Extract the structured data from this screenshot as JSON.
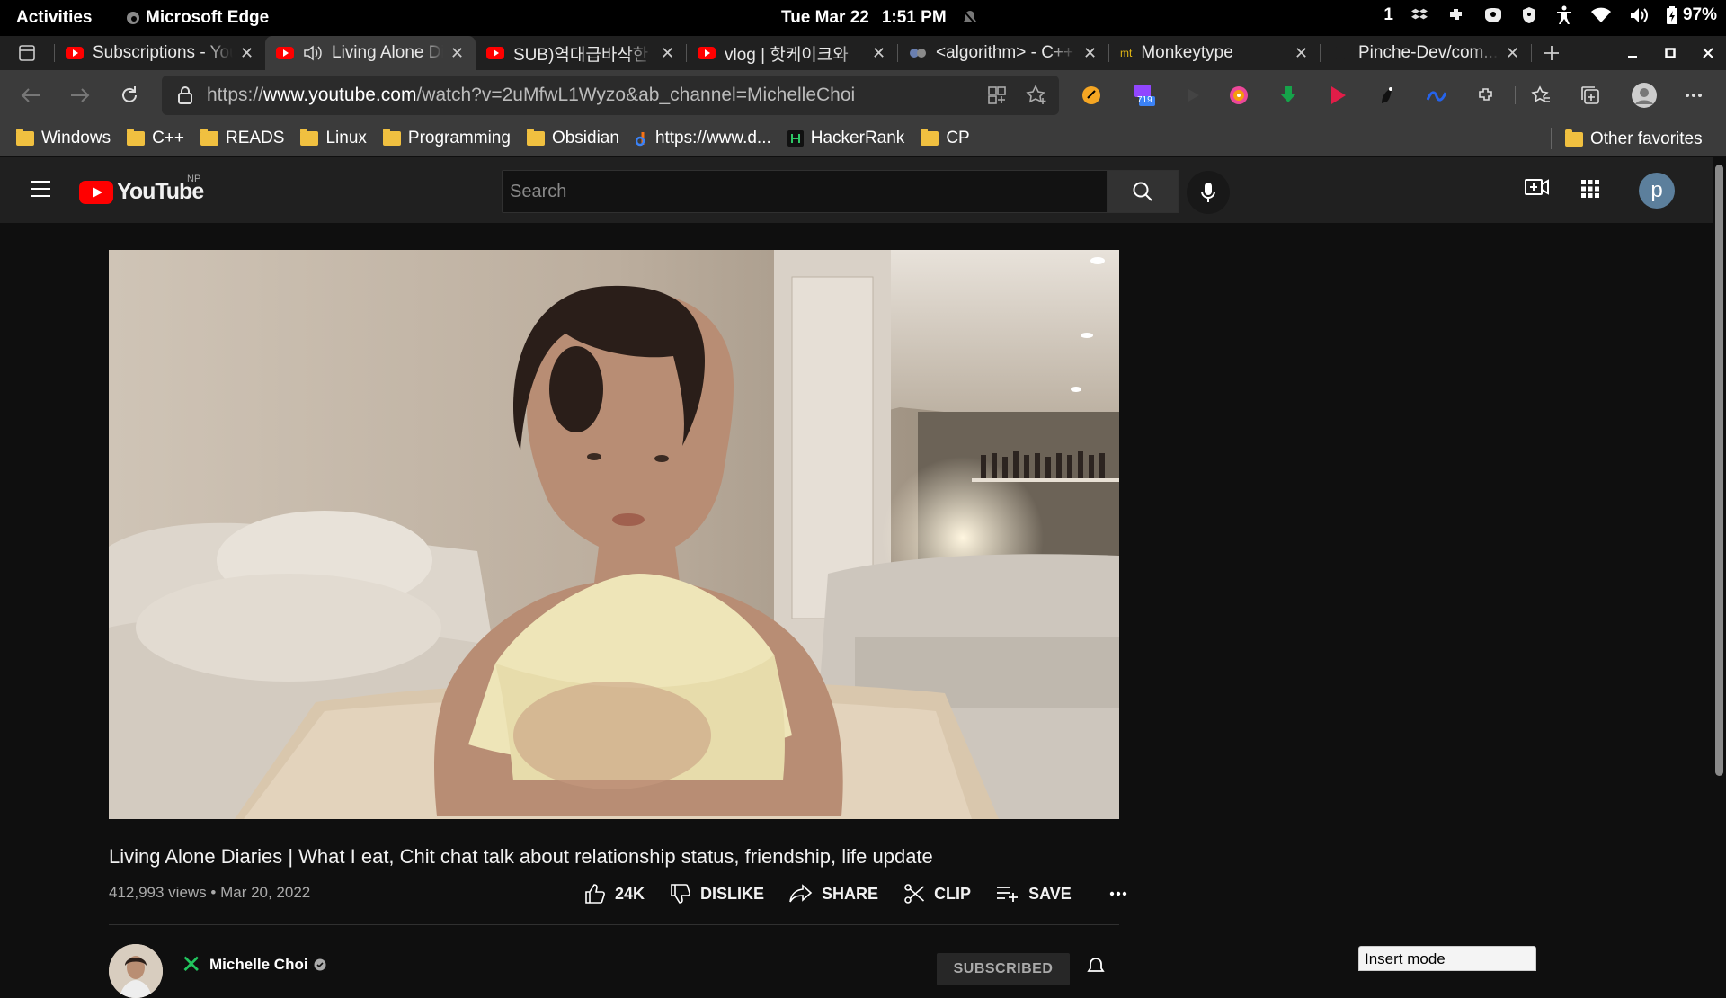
{
  "system_bar": {
    "activities": "Activities",
    "app_name": "Microsoft Edge",
    "date": "Tue Mar 22",
    "time": "1:51 PM",
    "workspace": "1",
    "battery": "97%"
  },
  "tabs": [
    {
      "title": "Subscriptions - YouTube",
      "favicon": "youtube-icon",
      "active": false
    },
    {
      "title": "Living Alone Diaries",
      "favicon": "youtube-icon",
      "audio": true,
      "active": true
    },
    {
      "title": "SUB)역대급바삭한",
      "favicon": "youtube-icon",
      "active": false
    },
    {
      "title": "vlog | 핫케이크와",
      "favicon": "youtube-icon",
      "active": false
    },
    {
      "title": "<algorithm> - C++",
      "favicon": "cpp-icon",
      "active": false
    },
    {
      "title": "Monkeytype",
      "favicon": "monkeytype-icon",
      "active": false
    },
    {
      "title": "Pinche-Dev/com...",
      "favicon": "github-icon",
      "active": false
    }
  ],
  "address_bar": {
    "prefix": "https://",
    "host": "www.youtube.com",
    "path": "/watch?v=2uMfwL1Wyzo&ab_channel=MichelleChoi"
  },
  "extension_badge": "719",
  "bookmarks": [
    {
      "label": "Windows",
      "icon": "folder-icon"
    },
    {
      "label": "C++",
      "icon": "folder-icon"
    },
    {
      "label": "READS",
      "icon": "folder-icon"
    },
    {
      "label": "Linux",
      "icon": "folder-icon"
    },
    {
      "label": "Programming",
      "icon": "folder-icon"
    },
    {
      "label": "Obsidian",
      "icon": "folder-icon"
    },
    {
      "label": "https://www.d...",
      "icon": "site-icon"
    },
    {
      "label": "HackerRank",
      "icon": "hackerrank-icon"
    },
    {
      "label": "CP",
      "icon": "folder-icon"
    }
  ],
  "other_favorites": "Other favorites",
  "youtube": {
    "logo_text": "YouTube",
    "region": "NP",
    "search_placeholder": "Search",
    "avatar_letter": "p"
  },
  "video": {
    "title": "Living Alone Diaries | What I eat, Chit chat talk about relationship status, friendship, life update",
    "meta": "412,993 views • Mar 20, 2022",
    "likes": "24K",
    "dislike": "DISLIKE",
    "share": "SHARE",
    "clip": "CLIP",
    "save": "SAVE"
  },
  "channel": {
    "name": "Michelle Choi",
    "subscribe_label": "SUBSCRIBED"
  },
  "status_popup": "Insert mode",
  "colors": {
    "yt_red": "#ff0000",
    "bg": "#0f0f0f",
    "chrome": "#3b3b3b"
  }
}
